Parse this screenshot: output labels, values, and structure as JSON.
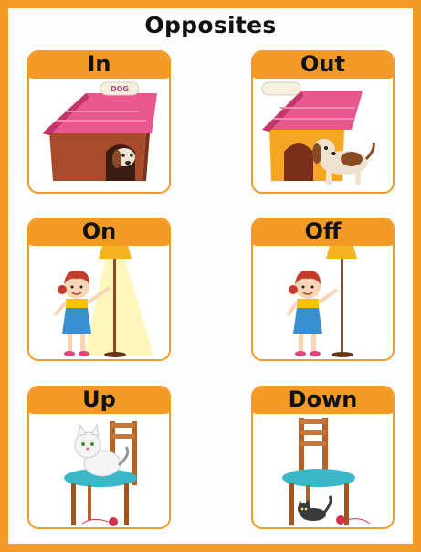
{
  "title": "Opposites",
  "cards": [
    {
      "label": "In"
    },
    {
      "label": "Out"
    },
    {
      "label": "On"
    },
    {
      "label": "Off"
    },
    {
      "label": "Up"
    },
    {
      "label": "Down"
    }
  ],
  "sign_text": "DOG",
  "colors": {
    "frame": "#f39a26",
    "roof": "#e8578f",
    "house": "#a84a2c",
    "lamp": "#f5b320",
    "chair": "#b4622a",
    "cushion": "#3ab8c7"
  }
}
